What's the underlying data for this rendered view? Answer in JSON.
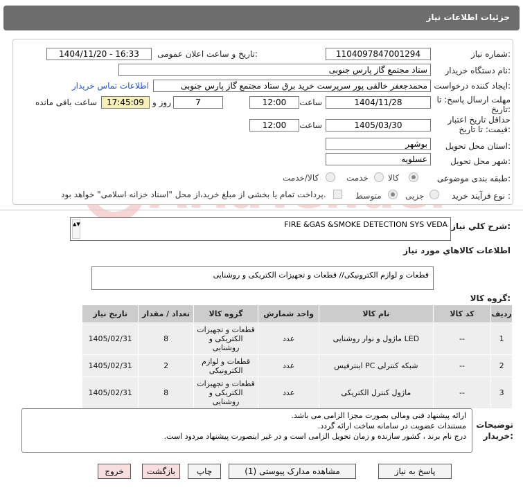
{
  "title": "جزئیات اطلاعات نیاز",
  "fields": {
    "need_number_label": "شماره نیاز:",
    "need_number": "1104097847001294",
    "announce_label": "تاریخ و ساعت اعلان عمومی:",
    "announce_value": "1404/11/20 - 16:33",
    "buyer_org_label": "نام دستگاه خریدار:",
    "buyer_org": "ستاد مجتمع گاز پارس جنوبی",
    "creator_label": "ایجاد کننده درخواست:",
    "creator": "محمدجعفر خالقی پور سرپرست خرید برق ستاد مجتمع گاز پارس جنوبی",
    "contact_link": "اطلاعات تماس خریدار",
    "deadline_label": "مهلت ارسال پاسخ: تا تاریخ:",
    "deadline_date": "1404/11/28",
    "time_label": "ساعت",
    "deadline_time": "12:00",
    "days": "7",
    "days_label": "روز و",
    "remaining": "17:45:09",
    "remaining_label": "ساعت باقی مانده",
    "validity_label": "حداقل تاریخ اعتبار قیمت: تا تاریخ:",
    "validity_date": "1405/03/30",
    "validity_time": "12:00",
    "province_label": "استان محل تحویل:",
    "province": "بوشهر",
    "city_label": "شهر محل تحویل:",
    "city": "عسلویه",
    "category_label": "طبقه بندی موضوعی:",
    "category_options": [
      "کالا",
      "خدمت",
      "کالا/خدمت"
    ],
    "process_label": "نوع فرآیند خرید :",
    "process_options": [
      "جزیی",
      "متوسط"
    ],
    "payment_note": "پرداخت تمام یا بخشی از مبلغ خرید،از محل \"اسناد خزانه اسلامی\" خواهد بود."
  },
  "summary": {
    "label": "شرح کلي نياز:",
    "value": "FIRE &GAS &SMOKE DETECTION SYS VEDA"
  },
  "goods": {
    "section_title": "اطلاعات كالاهاي مورد نياز",
    "group_label": "گروه کالا:",
    "group_value": "قطعات و لوازم الکترونیکی// قطعات و تجهیزات الکتریکی و روشنایی"
  },
  "table": {
    "headers": [
      "ردیف",
      "کد کالا",
      "نام کالا",
      "واحد شمارش",
      "گروه کالا",
      "تعداد / مقدار",
      "تاریخ نیاز"
    ],
    "rows": [
      [
        "1",
        "--",
        "ماژول و نوار روشنایی LED",
        "عدد",
        "قطعات و تجهیزات الکتریکی و روشنایی",
        "8",
        "1405/02/31"
      ],
      [
        "2",
        "--",
        "اینترفیس PC شبکه کنترلی",
        "عدد",
        "قطعات و لوازم الکترونیکی",
        "2",
        "1405/02/31"
      ],
      [
        "3",
        "--",
        "ماژول کنترل الکتریکی",
        "عدد",
        "قطعات و تجهیزات الکتریکی و روشنایی",
        "8",
        "1405/02/31"
      ]
    ]
  },
  "notes": {
    "label": "توضیحات خریدار:",
    "lines": [
      "ارائه پیشنهاد فنی ومالی بصورت مجزا الزامی می باشد.",
      "مستندات عضویت در سامانه ساخت ارائه گردد.",
      "درج نام برند ، کشور سازنده و زمان تحویل الزامی است و در غیر اینصورت پیشنهاد مردود است."
    ]
  },
  "buttons": {
    "reply": "پاسخ به نیاز",
    "attachments": "مشاهده مدارک پیوستی (1)",
    "print": "چاپ",
    "back": "بازگشت",
    "exit": "خروج"
  },
  "watermark_text": "AriaTender.neT"
}
